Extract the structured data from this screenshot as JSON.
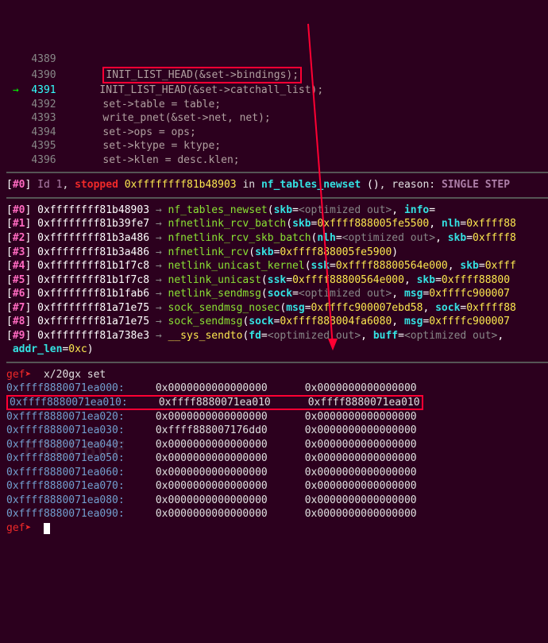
{
  "code": {
    "lines": [
      {
        "n": "4389",
        "txt": ""
      },
      {
        "n": "4390",
        "boxed": true,
        "txt": "INIT_LIST_HEAD(&set->bindings);"
      },
      {
        "n": "4391",
        "cur": true,
        "txt": "INIT_LIST_HEAD(&set->catchall_list);"
      },
      {
        "n": "4392",
        "txt": "set->table = table;"
      },
      {
        "n": "4393",
        "txt": "write_pnet(&set->net, net);"
      },
      {
        "n": "4394",
        "txt": "set->ops = ops;"
      },
      {
        "n": "4395",
        "txt": "set->ktype = ktype;"
      },
      {
        "n": "4396",
        "txt": "set->klen = desc.klen;"
      }
    ]
  },
  "thread": {
    "idx": "#0",
    "id": "Id 1",
    "state": "stopped",
    "addr": "0xffffffff81b48903",
    "func": "nf_tables_newset",
    "reason": "SINGLE STEP"
  },
  "backtrace": [
    {
      "i": "#0",
      "addr": "0xffffffff81b48903",
      "func": "nf_tables_newset",
      "args": "(skb=<optimized out>, info=<optimized ou"
    },
    {
      "i": "#1",
      "addr": "0xffffffff81b39fe7",
      "func": "nfnetlink_rcv_batch",
      "args": "(skb=0xffff888005fe5500, nlh=0xffff88"
    },
    {
      "i": "#2",
      "addr": "0xffffffff81b3a486",
      "func": "nfnetlink_rcv_skb_batch",
      "args": "(nlh=<optimized out>, skb=0xffff8"
    },
    {
      "i": "#3",
      "addr": "0xffffffff81b3a486",
      "func": "nfnetlink_rcv",
      "args": "(skb=0xffff888005fe5900)"
    },
    {
      "i": "#4",
      "addr": "0xffffffff81b1f7c8",
      "func": "netlink_unicast_kernel",
      "args": "(ssk=0xffff88800564e000, skb=0xfff"
    },
    {
      "i": "#5",
      "addr": "0xffffffff81b1f7c8",
      "func": "netlink_unicast",
      "args": "(ssk=0xffff88800564e000, skb=0xffff88800"
    },
    {
      "i": "#6",
      "addr": "0xffffffff81b1fab6",
      "func": "netlink_sendmsg",
      "args": "(sock=<optimized out>, msg=0xffffc900007"
    },
    {
      "i": "#7",
      "addr": "0xffffffff81a71e75",
      "func": "sock_sendmsg_nosec",
      "args": "(msg=0xffffc900007ebd58, sock=0xffff88"
    },
    {
      "i": "#8",
      "addr": "0xffffffff81a71e75",
      "func": "sock_sendmsg",
      "args": "(sock=0xffff888004fa6080, msg=0xffffc900007"
    },
    {
      "i": "#9",
      "addr": "0xffffffff81a738e3",
      "func": "__sys_sendto",
      "args": "(fd=<optimized out>, buff=<optimized out>, ",
      "tail": "addr_len=0xc)"
    }
  ],
  "gef_cmd": "x/20gx set",
  "memory": [
    {
      "addr": "0xffff8880071ea000:",
      "v1": "0x0000000000000000",
      "v2": "0x0000000000000000"
    },
    {
      "addr": "0xffff8880071ea010:",
      "v1": "0xffff8880071ea010",
      "v2": "0xffff8880071ea010",
      "box": true
    },
    {
      "addr": "0xffff8880071ea020:",
      "v1": "0x0000000000000000",
      "v2": "0x0000000000000000"
    },
    {
      "addr": "0xffff8880071ea030:",
      "v1": "0xffff888007176dd0",
      "v2": "0x0000000000000000"
    },
    {
      "addr": "0xffff8880071ea040:",
      "v1": "0x0000000000000000",
      "v2": "0x0000000000000000"
    },
    {
      "addr": "0xffff8880071ea050:",
      "v1": "0x0000000000000000",
      "v2": "0x0000000000000000"
    },
    {
      "addr": "0xffff8880071ea060:",
      "v1": "0x0000000000000000",
      "v2": "0x0000000000000000"
    },
    {
      "addr": "0xffff8880071ea070:",
      "v1": "0x0000000000000000",
      "v2": "0x0000000000000000"
    },
    {
      "addr": "0xffff8880071ea080:",
      "v1": "0x0000000000000000",
      "v2": "0x0000000000000000"
    },
    {
      "addr": "0xffff8880071ea090:",
      "v1": "0x0000000000000000",
      "v2": "0x0000000000000000"
    }
  ],
  "watermark": "FREEBUF"
}
